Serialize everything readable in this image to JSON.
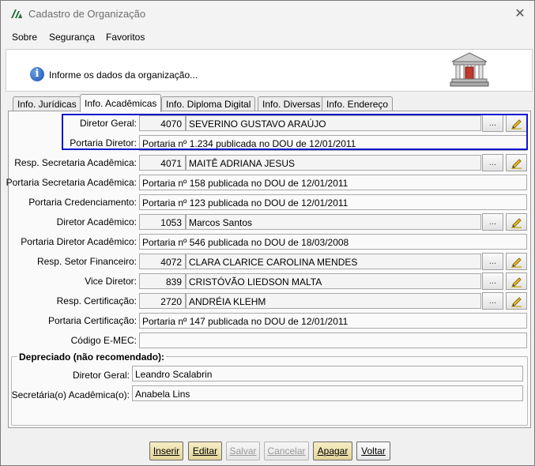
{
  "window": {
    "title": "Cadastro de Organização"
  },
  "menu": [
    {
      "label": "Sobre"
    },
    {
      "label": "Segurança"
    },
    {
      "label": "Favoritos"
    }
  ],
  "header": {
    "message": "Informe os dados da organização..."
  },
  "tabs": [
    {
      "label": "Info. Jurídicas"
    },
    {
      "label": "Info. Acadêmicas"
    },
    {
      "label": "Info. Diploma Digital"
    },
    {
      "label": "Info. Diversas"
    },
    {
      "label": "Info. Endereço"
    }
  ],
  "form": {
    "diretor_geral": {
      "label": "Diretor Geral:",
      "code": "4070",
      "name": "SEVERINO GUSTAVO ARAÚJO"
    },
    "portaria_diretor": {
      "label": "Portaria Diretor:",
      "value": "Portaria nº 1.234 publicada no DOU de 12/01/2011"
    },
    "resp_secretaria": {
      "label": "Resp. Secretaria Acadêmica:",
      "code": "4071",
      "name": "MAITÊ ADRIANA JESUS"
    },
    "portaria_secretaria": {
      "label": "Portaria Secretaria Acadêmica:",
      "value": "Portaria nº 158 publicada no DOU de 12/01/2011"
    },
    "portaria_credenciamento": {
      "label": "Portaria Credenciamento:",
      "value": "Portaria nº 123 publicada no DOU de 12/01/2011"
    },
    "diretor_academico": {
      "label": "Diretor Acadêmico:",
      "code": "1053",
      "name": "Marcos Santos"
    },
    "portaria_diretor_academico": {
      "label": "Portaria Diretor Acadêmico:",
      "value": "Portaria nº 546 publicada no DOU de 18/03/2008"
    },
    "resp_setor_financeiro": {
      "label": "Resp. Setor Financeiro:",
      "code": "4072",
      "name": "CLARA CLARICE CAROLINA MENDES"
    },
    "vice_diretor": {
      "label": "Vice Diretor:",
      "code": "839",
      "name": "CRISTÓVÃO LIEDSON MALTA"
    },
    "resp_certificacao": {
      "label": "Resp. Certificação:",
      "code": "2720",
      "name": "ANDRÉIA KLEHM"
    },
    "portaria_certificacao": {
      "label": "Portaria Certificação:",
      "value": "Portaria nº 147 publicada no DOU de 12/01/2011"
    },
    "codigo_emec": {
      "label": "Código E-MEC:",
      "value": ""
    },
    "lookup_button": "..."
  },
  "deprecated": {
    "title": "Depreciado (não recomendado):",
    "diretor_geral": {
      "label": "Diretor Geral:",
      "value": "Leandro Scalabrin"
    },
    "secretaria": {
      "label": "Secretária(o) Acadêmica(o):",
      "value": "Anabela Lins"
    }
  },
  "footer": {
    "inserir": "Inserir",
    "editar": "Editar",
    "salvar": "Salvar",
    "cancelar": "Cancelar",
    "apagar": "Apagar",
    "voltar": "Voltar"
  },
  "colors": {
    "highlight": "#1414d0",
    "accent_button": "#e9dba5",
    "window_bg": "#f0f0f0"
  }
}
